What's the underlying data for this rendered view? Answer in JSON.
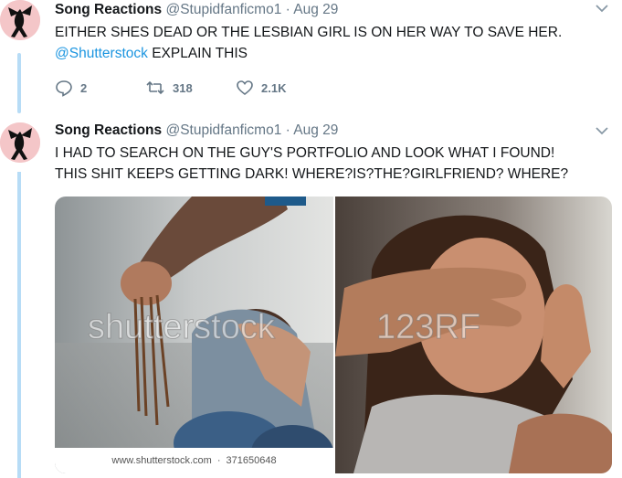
{
  "tweets": [
    {
      "author_name": "Song Reactions",
      "handle": "@Stupidfanficmo1",
      "separator": "·",
      "date": "Aug 29",
      "line1": "EITHER SHES DEAD OR THE LESBIAN GIRL IS ON HER WAY TO SAVE HER.",
      "mention": "@Shutterstock",
      "line2_rest": " EXPLAIN THIS",
      "replies": "2",
      "retweets": "318",
      "likes": "2.1K",
      "icons": [
        "reply-icon",
        "retweet-icon",
        "like-icon",
        "chevron-down-icon"
      ]
    },
    {
      "author_name": "Song Reactions",
      "handle": "@Stupidfanficmo1",
      "separator": "·",
      "date": "Aug 29",
      "line1": "I HAD TO SEARCH ON THE GUY'S PORTFOLIO AND LOOK WHAT I FOUND!",
      "line2": "THIS SHIT KEEPS GETTING DARK! WHERE?IS?THE?GIRLFRIEND? WHERE?"
    }
  ],
  "media": {
    "left_watermark": "shutterstock",
    "left_caption_site": "www.shutterstock.com",
    "left_caption_sep": "·",
    "left_caption_id": "371650648",
    "right_watermark": "123RF",
    "colors": {
      "link": "#1b95e0",
      "thread": "#b7dcf6",
      "muted": "#657786"
    }
  }
}
